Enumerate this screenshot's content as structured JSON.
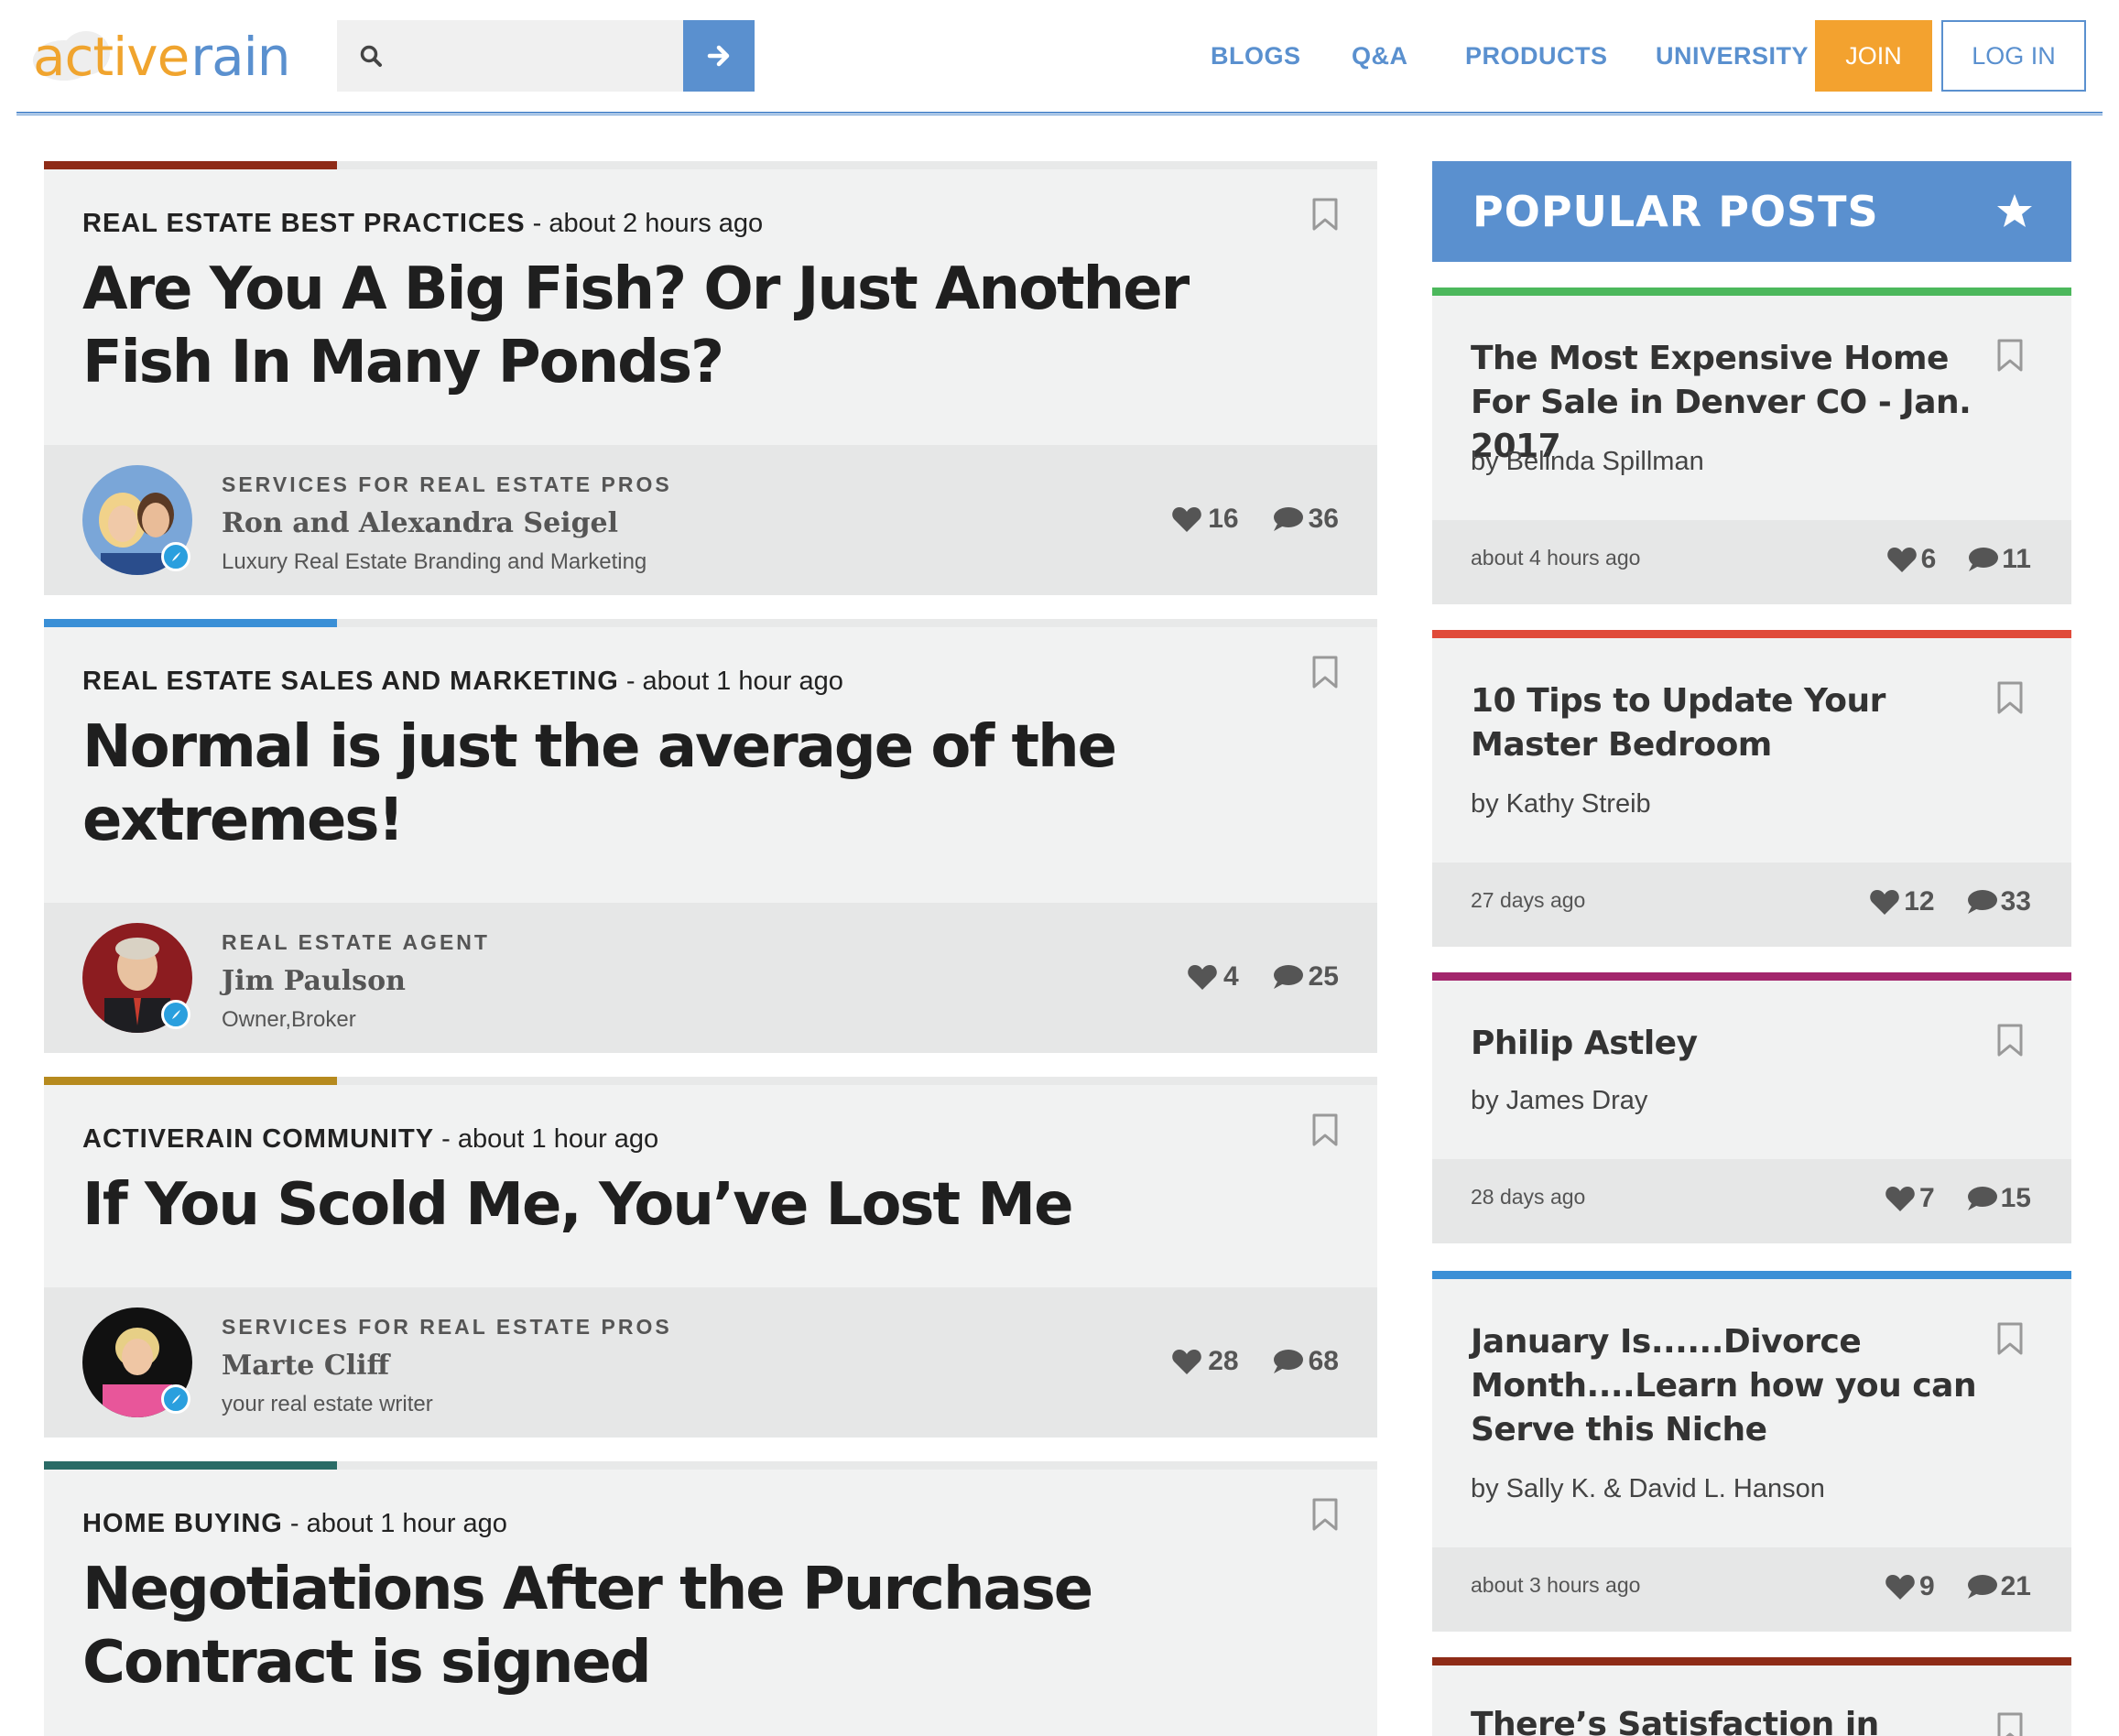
{
  "header": {
    "logo_active": "active",
    "logo_rain": "rain",
    "search_placeholder": "",
    "nav": [
      "BLOGS",
      "Q&A",
      "PRODUCTS",
      "UNIVERSITY"
    ],
    "join": "JOIN",
    "login": "LOG IN"
  },
  "colors": {
    "brand_blue": "#5a90cf",
    "brand_orange": "#f3a22f"
  },
  "feed": [
    {
      "category": "REAL ESTATE BEST PRACTICES",
      "time": " - about 2 hours ago",
      "title": "Are You A Big Fish? Or Just Another Fish In Many Ponds?",
      "accent": "#8e2b17",
      "role": "SERVICES FOR REAL ESTATE PROS",
      "author": "Ron and Alexandra Seigel",
      "tagline": "Luxury Real Estate Branding and Marketing",
      "likes": "16",
      "comments": "36"
    },
    {
      "category": "REAL ESTATE SALES AND MARKETING",
      "time": " - about 1 hour ago",
      "title": "Normal is just the average of the extremes!",
      "accent": "#3a8fd6",
      "role": "REAL ESTATE AGENT",
      "author": "Jim Paulson",
      "tagline": "Owner,Broker",
      "likes": "4",
      "comments": "25"
    },
    {
      "category": "ACTIVERAIN COMMUNITY",
      "time": " - about 1 hour ago",
      "title": "If You Scold Me, You’ve Lost Me",
      "accent": "#b68a1e",
      "role": "SERVICES FOR REAL ESTATE PROS",
      "author": "Marte Cliff",
      "tagline": "your real estate writer",
      "likes": "28",
      "comments": "68"
    },
    {
      "category": "HOME BUYING",
      "time": " - about 1 hour ago",
      "title": "Negotiations After the Purchase Contract is signed",
      "accent": "#2a6b66"
    }
  ],
  "popular": {
    "heading": "POPULAR POSTS",
    "posts": [
      {
        "title": "The Most Expensive Home For Sale in Denver CO - Jan. 2017",
        "by": "by Belinda Spillman",
        "time": "about 4 hours ago",
        "likes": "6",
        "comments": "11",
        "bar": "#4cb85c"
      },
      {
        "title": "10 Tips to Update Your Master Bedroom",
        "by": "by Kathy Streib",
        "time": "27 days ago",
        "likes": "12",
        "comments": "33",
        "bar": "#e04b3a"
      },
      {
        "title": "Philip Astley",
        "by": "by James Dray",
        "time": "28 days ago",
        "likes": "7",
        "comments": "15",
        "bar": "#a3266c"
      },
      {
        "title": "January Is......Divorce Month....Learn how you can Serve this Niche",
        "by": "by Sally K. & David L. Hanson",
        "time": "about 3 hours ago",
        "likes": "9",
        "comments": "21",
        "bar": "#3a8fd6"
      },
      {
        "title": "There’s Satisfaction in",
        "bar": "#8e2b17"
      }
    ]
  }
}
